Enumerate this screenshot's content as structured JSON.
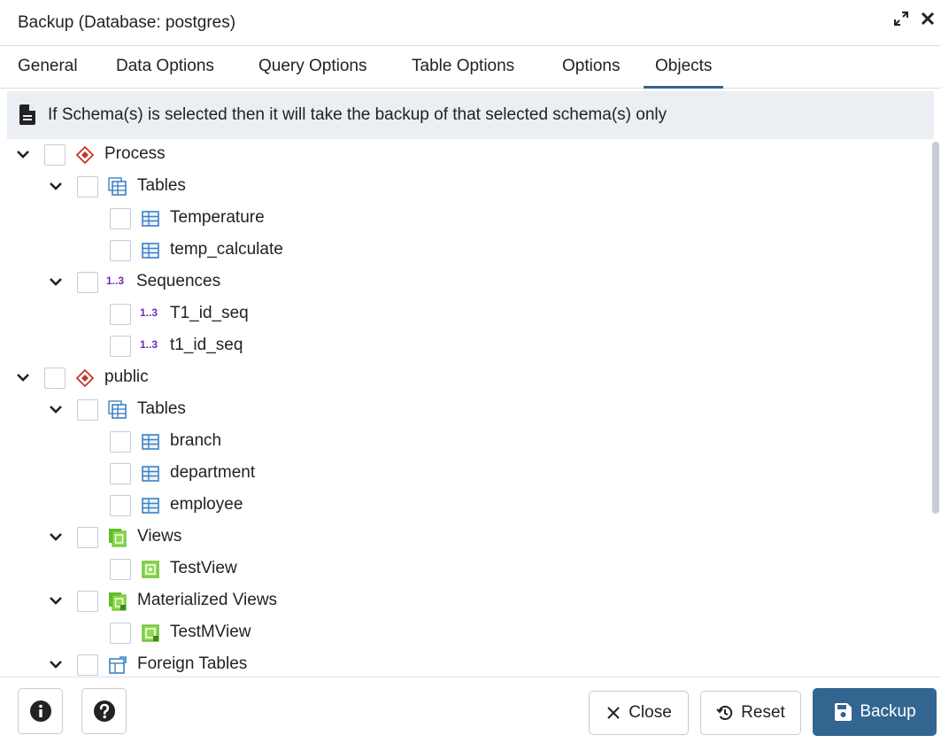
{
  "dialog": {
    "title": "Backup (Database: postgres)"
  },
  "tabs": [
    {
      "label": "General"
    },
    {
      "label": "Data Options"
    },
    {
      "label": "Query Options"
    },
    {
      "label": "Table Options"
    },
    {
      "label": "Options"
    },
    {
      "label": "Objects"
    }
  ],
  "active_tab": "Objects",
  "info": {
    "text": "If Schema(s) is selected then it will take the backup of that selected schema(s) only",
    "icon": "document-icon"
  },
  "tree": [
    {
      "label": "Process",
      "icon": "schema-icon"
    },
    {
      "label": "Tables",
      "icon": "tables-icon"
    },
    {
      "label": "Temperature",
      "icon": "table-icon"
    },
    {
      "label": "temp_calculate",
      "icon": "table-icon"
    },
    {
      "label": "Sequences",
      "icon": "sequence-icon",
      "icon_text": "1..3"
    },
    {
      "label": "T1_id_seq",
      "icon": "sequence-icon",
      "icon_text": "1..3"
    },
    {
      "label": "t1_id_seq",
      "icon": "sequence-icon",
      "icon_text": "1..3"
    },
    {
      "label": "public",
      "icon": "schema-icon"
    },
    {
      "label": "Tables",
      "icon": "tables-icon"
    },
    {
      "label": "branch",
      "icon": "table-icon"
    },
    {
      "label": "department",
      "icon": "table-icon"
    },
    {
      "label": "employee",
      "icon": "table-icon"
    },
    {
      "label": "Views",
      "icon": "views-icon"
    },
    {
      "label": "TestView",
      "icon": "view-icon"
    },
    {
      "label": "Materialized Views",
      "icon": "mviews-icon"
    },
    {
      "label": "TestMView",
      "icon": "mview-icon"
    },
    {
      "label": "Foreign Tables",
      "icon": "foreign-tables-icon"
    }
  ],
  "footer": {
    "close_label": "Close",
    "reset_label": "Reset",
    "backup_label": "Backup"
  },
  "colors": {
    "primary": "#326690",
    "schema_icon": "#c0392b",
    "table_icon": "#3b82c4",
    "view_icon": "#5fbf2a",
    "sequence_icon": "#6f2ab2"
  }
}
